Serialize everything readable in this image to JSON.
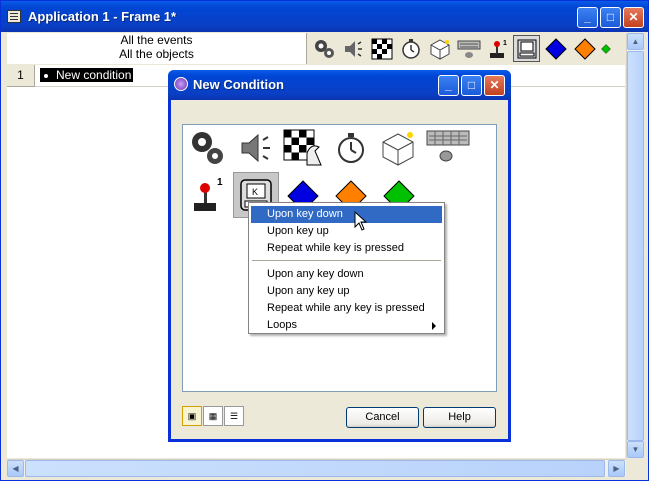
{
  "main_window": {
    "title": "Application 1 - Frame 1*",
    "min_label": "_",
    "max_label": "□",
    "close_label": "✕"
  },
  "event_header": {
    "line1": "All the events",
    "line2": "All the objects"
  },
  "event_editor": {
    "row_number": "1",
    "condition_label": "New condition"
  },
  "toolbar": {
    "icons": [
      "gear-icon",
      "speaker-icon",
      "chess-board-icon",
      "stopwatch-icon",
      "box-icon",
      "keyboard-mouse-icon",
      "joystick-icon",
      "keyboard-key-icon",
      "blue-diamond-icon",
      "orange-diamond-icon",
      "green-diamond-icon"
    ]
  },
  "dialog": {
    "title": "New Condition",
    "cancel_label": "Cancel",
    "help_label": "Help",
    "joystick_badge": "1",
    "key_label": "K"
  },
  "context_menu": {
    "items": [
      {
        "label": "Upon key down",
        "highlighted": true
      },
      {
        "label": "Upon key up"
      },
      {
        "label": "Repeat while key is pressed"
      },
      {
        "label": "Upon any key down"
      },
      {
        "label": "Upon any key up"
      },
      {
        "label": "Repeat while any key is pressed"
      },
      {
        "label": "Loops",
        "submenu": true
      }
    ]
  },
  "colors": {
    "titlebar_blue": "#0a3fc4",
    "menu_highlight": "#316ac5",
    "blue_diamond": "#0000e0",
    "orange_diamond": "#ff7f00",
    "green_diamond": "#00c000"
  }
}
